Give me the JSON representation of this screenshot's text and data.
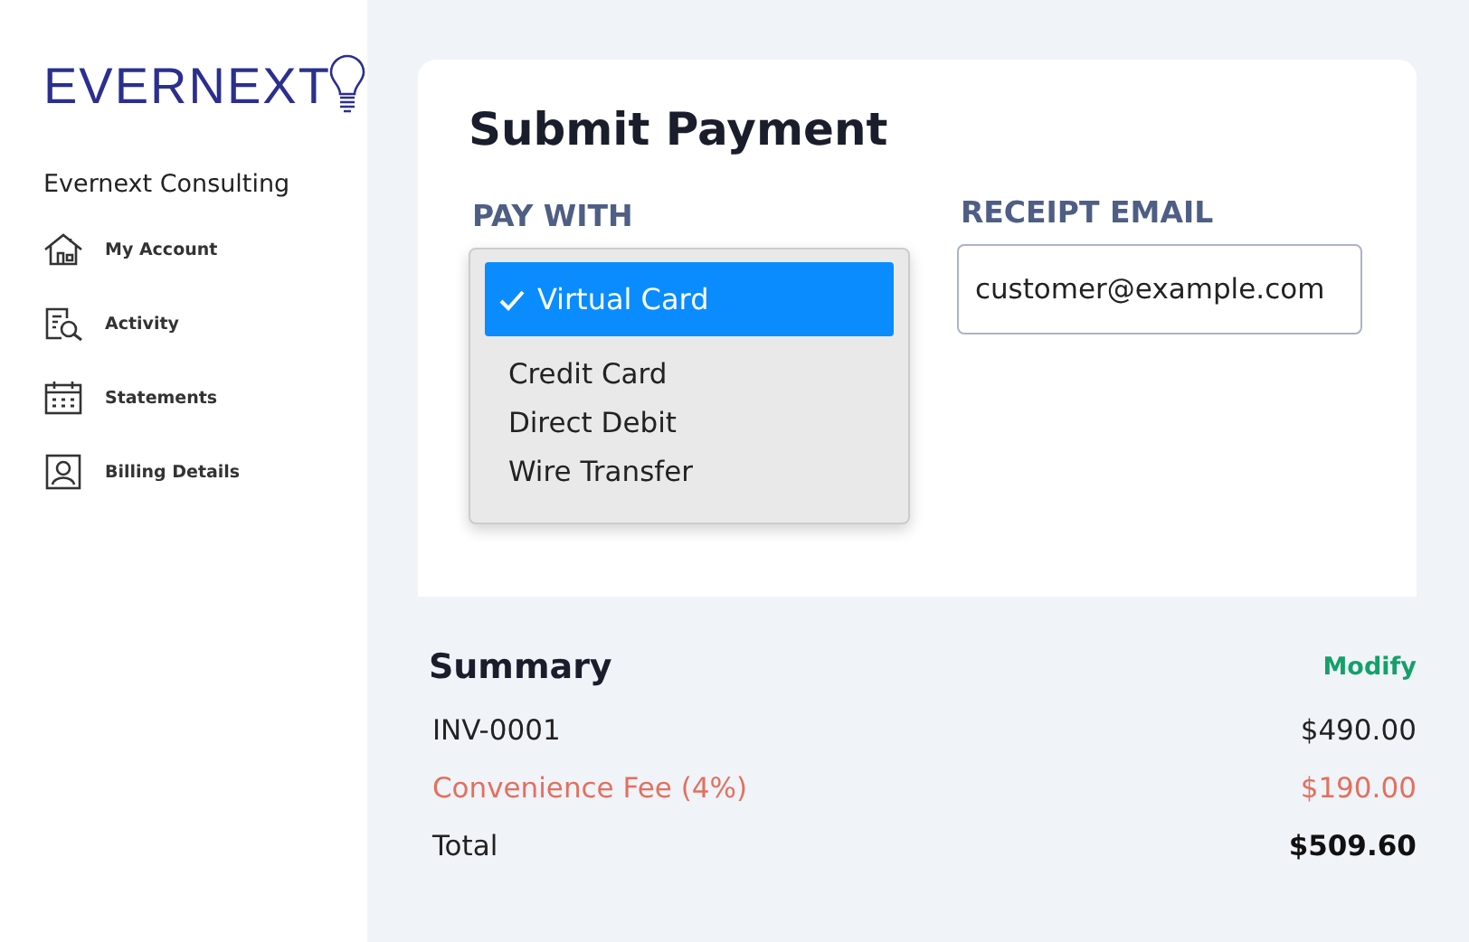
{
  "sidebar": {
    "logo": "EVERNEXT",
    "company": "Evernext Consulting",
    "items": [
      {
        "label": "My Account"
      },
      {
        "label": "Activity"
      },
      {
        "label": "Statements"
      },
      {
        "label": "Billing Details"
      }
    ]
  },
  "payment": {
    "title": "Submit Payment",
    "pay_with": {
      "label": "PAY WITH",
      "options": [
        {
          "label": "Virtual Card",
          "selected": true
        },
        {
          "label": "Credit Card",
          "selected": false
        },
        {
          "label": "Direct Debit",
          "selected": false
        },
        {
          "label": "Wire Transfer",
          "selected": false
        }
      ]
    },
    "receipt_email": {
      "label": "RECEIPT EMAIL",
      "value": "customer@example.com"
    }
  },
  "summary": {
    "title": "Summary",
    "action": "Modify",
    "rows": [
      {
        "kind": "item",
        "label": "INV-0001",
        "amount": "$490.00"
      },
      {
        "kind": "fee",
        "label": "Convenience Fee (4%)",
        "amount": "$190.00"
      },
      {
        "kind": "total",
        "label": "Total",
        "amount": "$509.60"
      }
    ]
  }
}
